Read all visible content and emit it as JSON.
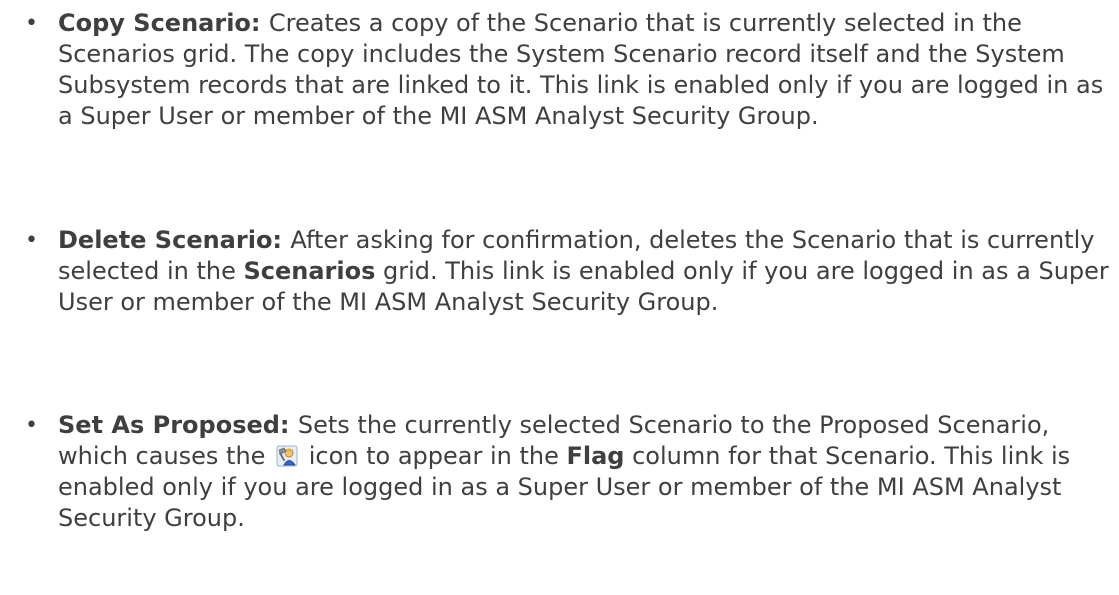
{
  "items": [
    {
      "term": "Copy Scenario:",
      "text": "Creates a copy of the Scenario that is currently selected in the Scenarios grid. The copy includes the System Scenario record itself and the System Subsystem records that are linked to it.  This link is enabled only if you are logged in as a Super User or member of the MI ASM Analyst Security Group."
    },
    {
      "term": "Delete Scenario:",
      "text_before": "After asking for confirmation, deletes the Scenario that is currently selected in the ",
      "bold_word": "Scenarios",
      "text_after": " grid.  This link is enabled only if you are logged in as a Super User or member of the MI ASM Analyst Security Group."
    },
    {
      "term": "Set As Proposed:",
      "text_before": "Sets the currently selected Scenario to the Proposed Scenario, which causes the ",
      "icon": "proposed-scenario-flag-icon",
      "text_middle": " icon to appear in the ",
      "bold_word": "Flag",
      "text_after": " column for that Scenario.  This link is enabled only if you are logged in as a Super User or member of the MI ASM Analyst Security Group."
    }
  ],
  "bullet_char": "•"
}
